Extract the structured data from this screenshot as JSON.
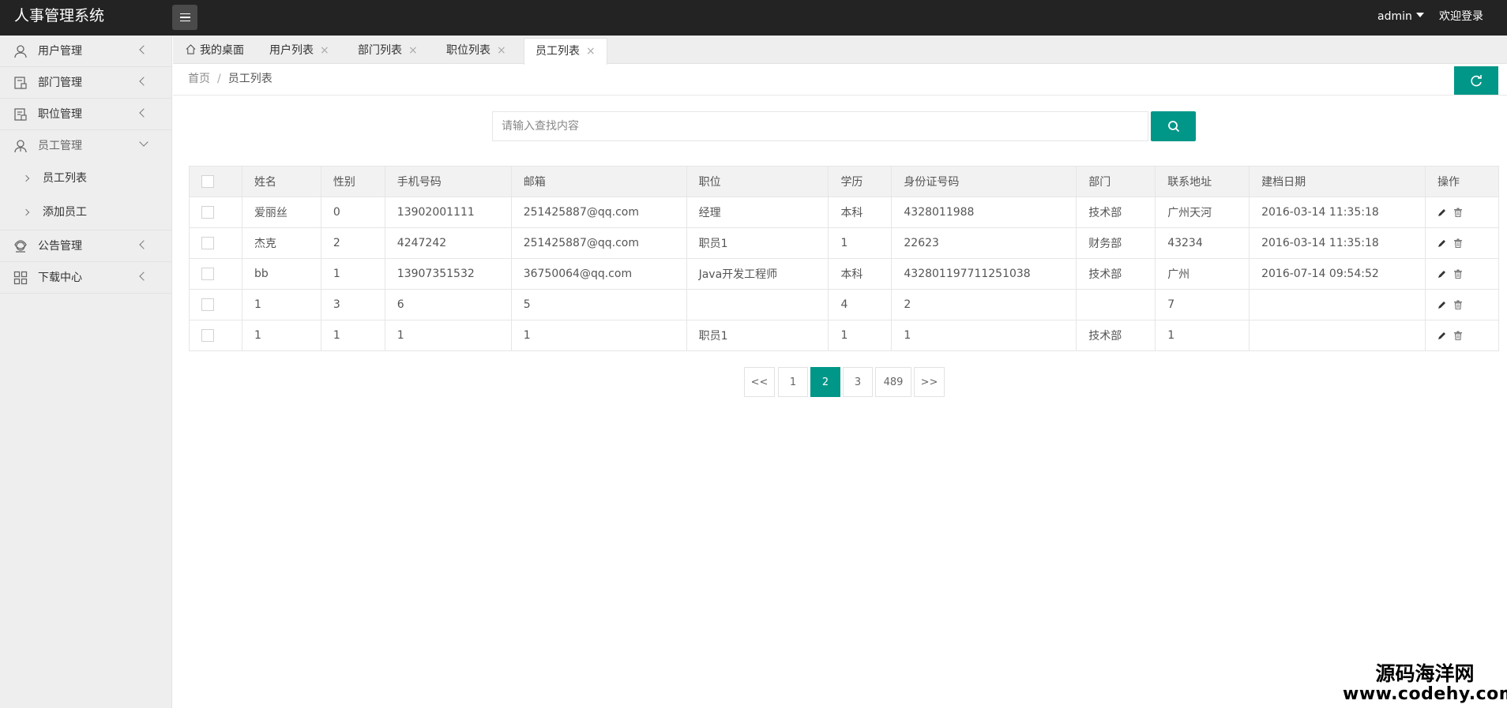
{
  "app": {
    "title": "人事管理系统"
  },
  "header": {
    "user": "admin",
    "welcome": "欢迎登录"
  },
  "sidebar": {
    "items": [
      {
        "label": "用户管理",
        "icon": "user-icon"
      },
      {
        "label": "部门管理",
        "icon": "department-icon"
      },
      {
        "label": "职位管理",
        "icon": "position-icon"
      },
      {
        "label": "员工管理",
        "icon": "employee-icon",
        "open": true,
        "children": [
          {
            "label": "员工列表"
          },
          {
            "label": "添加员工"
          }
        ]
      },
      {
        "label": "公告管理",
        "icon": "notice-icon"
      },
      {
        "label": "下载中心",
        "icon": "grid-icon"
      }
    ]
  },
  "tabs": [
    {
      "label": "我的桌面",
      "icon": "home-icon"
    },
    {
      "label": "用户列表",
      "close": "×"
    },
    {
      "label": "部门列表",
      "close": "×"
    },
    {
      "label": "职位列表",
      "close": "×"
    },
    {
      "label": "员工列表",
      "close": "×",
      "active": true
    }
  ],
  "breadcrumb": {
    "home": "首页",
    "separator": "/",
    "current": "员工列表"
  },
  "search": {
    "placeholder": "请输入查找内容",
    "value": ""
  },
  "table": {
    "columns": [
      "姓名",
      "性别",
      "手机号码",
      "邮箱",
      "职位",
      "学历",
      "身份证号码",
      "部门",
      "联系地址",
      "建档日期",
      "操作"
    ],
    "rows": [
      [
        "爱丽丝",
        "0",
        "13902001111",
        "251425887@qq.com",
        "经理",
        "本科",
        "4328011988",
        "技术部",
        "广州天河",
        "2016-03-14 11:35:18"
      ],
      [
        "杰克",
        "2",
        "4247242",
        "251425887@qq.com",
        "职员1",
        "1",
        "22623",
        "财务部",
        "43234",
        "2016-03-14 11:35:18"
      ],
      [
        "bb",
        "1",
        "13907351532",
        "36750064@qq.com",
        "Java开发工程师",
        "本科",
        "432801197711251038",
        "技术部",
        "广州",
        "2016-07-14 09:54:52"
      ],
      [
        "1",
        "3",
        "6",
        "5",
        "",
        "4",
        "2",
        "",
        "7",
        ""
      ],
      [
        "1",
        "1",
        "1",
        "1",
        "职员1",
        "1",
        "1",
        "技术部",
        "1",
        ""
      ]
    ]
  },
  "pagination": {
    "prev": "<<",
    "pages": [
      "1",
      "2",
      "3",
      "489"
    ],
    "current": "2",
    "next": ">>"
  },
  "watermark": {
    "line1": "源码海洋网",
    "line2": "www.codehy.com"
  },
  "colors": {
    "accent": "#009688",
    "topbar": "#232323",
    "sidebar": "#eeeeee"
  }
}
